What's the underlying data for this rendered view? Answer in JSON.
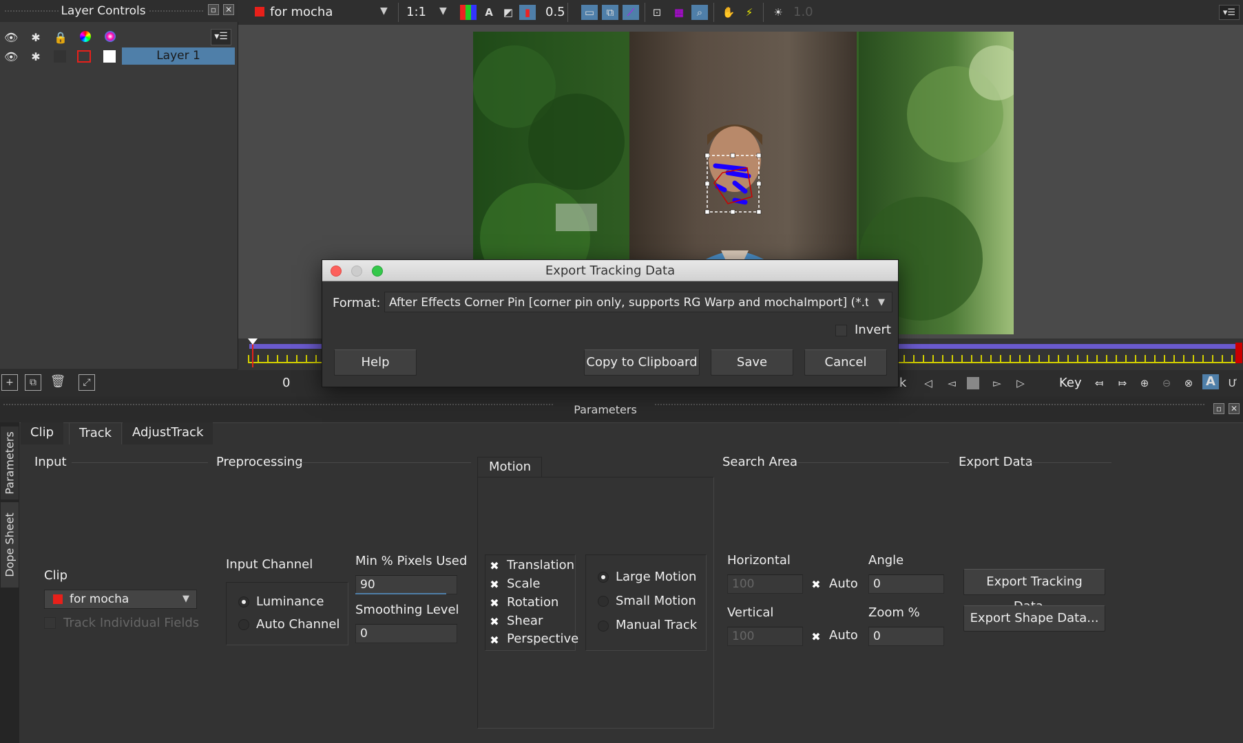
{
  "layer_panel": {
    "title": "Layer Controls",
    "layer_name": "Layer 1"
  },
  "toolbar": {
    "clip_name": "for mocha",
    "zoom": "1:1",
    "opacity": "0.5",
    "exposure": "1.0",
    "text_tool": "A"
  },
  "timeline": {
    "current_frame": "0"
  },
  "transport": {
    "partial_label": "ck",
    "key_label": "Key"
  },
  "params": {
    "header": "Parameters",
    "side_tabs": [
      "Parameters",
      "Dope Sheet"
    ],
    "tabs": [
      "Clip",
      "Track",
      "AdjustTrack"
    ],
    "sections": {
      "input": "Input",
      "preprocessing": "Preprocessing",
      "motion": "Motion",
      "search_area": "Search Area",
      "export_data": "Export Data"
    },
    "clip_label": "Clip",
    "clip_value": "for mocha",
    "track_individual_fields": "Track Individual Fields",
    "input_channel_label": "Input Channel",
    "channel_options": [
      "Luminance",
      "Auto Channel"
    ],
    "min_pixels_label": "Min % Pixels Used",
    "min_pixels_value": "90",
    "smoothing_label": "Smoothing Level",
    "smoothing_value": "0",
    "motion_types": [
      "Translation",
      "Scale",
      "Rotation",
      "Shear",
      "Perspective"
    ],
    "motion_modes": [
      "Large Motion",
      "Small Motion",
      "Manual Track"
    ],
    "horizontal_label": "Horizontal",
    "horizontal_value": "100",
    "vertical_label": "Vertical",
    "vertical_value": "100",
    "auto_label": "Auto",
    "angle_label": "Angle",
    "angle_value": "0",
    "zoom_label": "Zoom %",
    "zoom_value": "0",
    "export_tracking_btn": "Export Tracking Data...",
    "export_shape_btn": "Export Shape Data..."
  },
  "dialog": {
    "title": "Export Tracking Data",
    "format_label": "Format:",
    "format_value": "After Effects Corner Pin [corner pin only, supports RG Warp and mochaImport] (*.txt",
    "invert_label": "Invert",
    "help": "Help",
    "copy": "Copy to Clipboard",
    "save": "Save",
    "cancel": "Cancel"
  },
  "colors": {
    "accent_blue": "#4f7fa9",
    "clip_red": "#e8201a",
    "timeline_purple": "#6a5acd",
    "tick_yellow": "#d4d000"
  }
}
